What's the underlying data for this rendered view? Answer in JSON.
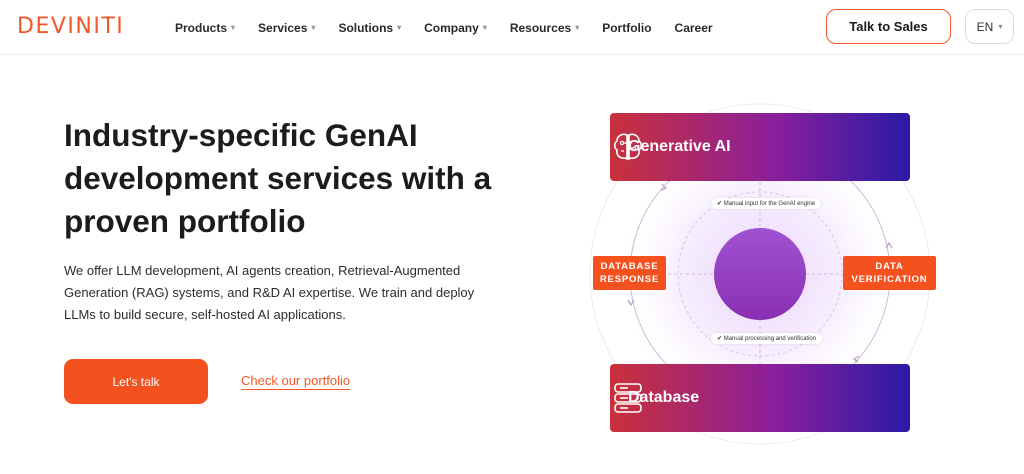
{
  "brand": {
    "logo_text": "DEVINITI",
    "accent": "#f0582b"
  },
  "nav": {
    "items": [
      {
        "label": "Products",
        "has_dropdown": true
      },
      {
        "label": "Services",
        "has_dropdown": true
      },
      {
        "label": "Solutions",
        "has_dropdown": true
      },
      {
        "label": "Company",
        "has_dropdown": true
      },
      {
        "label": "Resources",
        "has_dropdown": true
      },
      {
        "label": "Portfolio",
        "has_dropdown": false
      },
      {
        "label": "Career",
        "has_dropdown": false
      }
    ],
    "cta_label": "Talk to Sales",
    "language": "EN"
  },
  "hero": {
    "title": "Industry-specific GenAI development services with a proven portfolio",
    "description": "We offer LLM development, AI agents creation, Retrieval-Augmented Generation (RAG) systems, and R&D AI expertise. We train and deploy LLMs to build secure, self-hosted AI applications.",
    "primary_button": "Let's talk",
    "secondary_link": "Check our portfolio"
  },
  "diagram": {
    "top_card": {
      "label": "Generative AI",
      "icon": "brain-circuit-icon"
    },
    "bottom_card": {
      "label": "Database",
      "icon": "server-stack-icon"
    },
    "left_tag": "DATABASE RESPONSE",
    "right_tag": "DATA VERIFICATION",
    "chip_top": "Manual input for the GenAI engine",
    "chip_bottom": "Manual processing and verification",
    "center_icon": "person-icon",
    "gradient_colors": [
      "#c9313a",
      "#8a1f9c",
      "#2a1aa6"
    ]
  }
}
